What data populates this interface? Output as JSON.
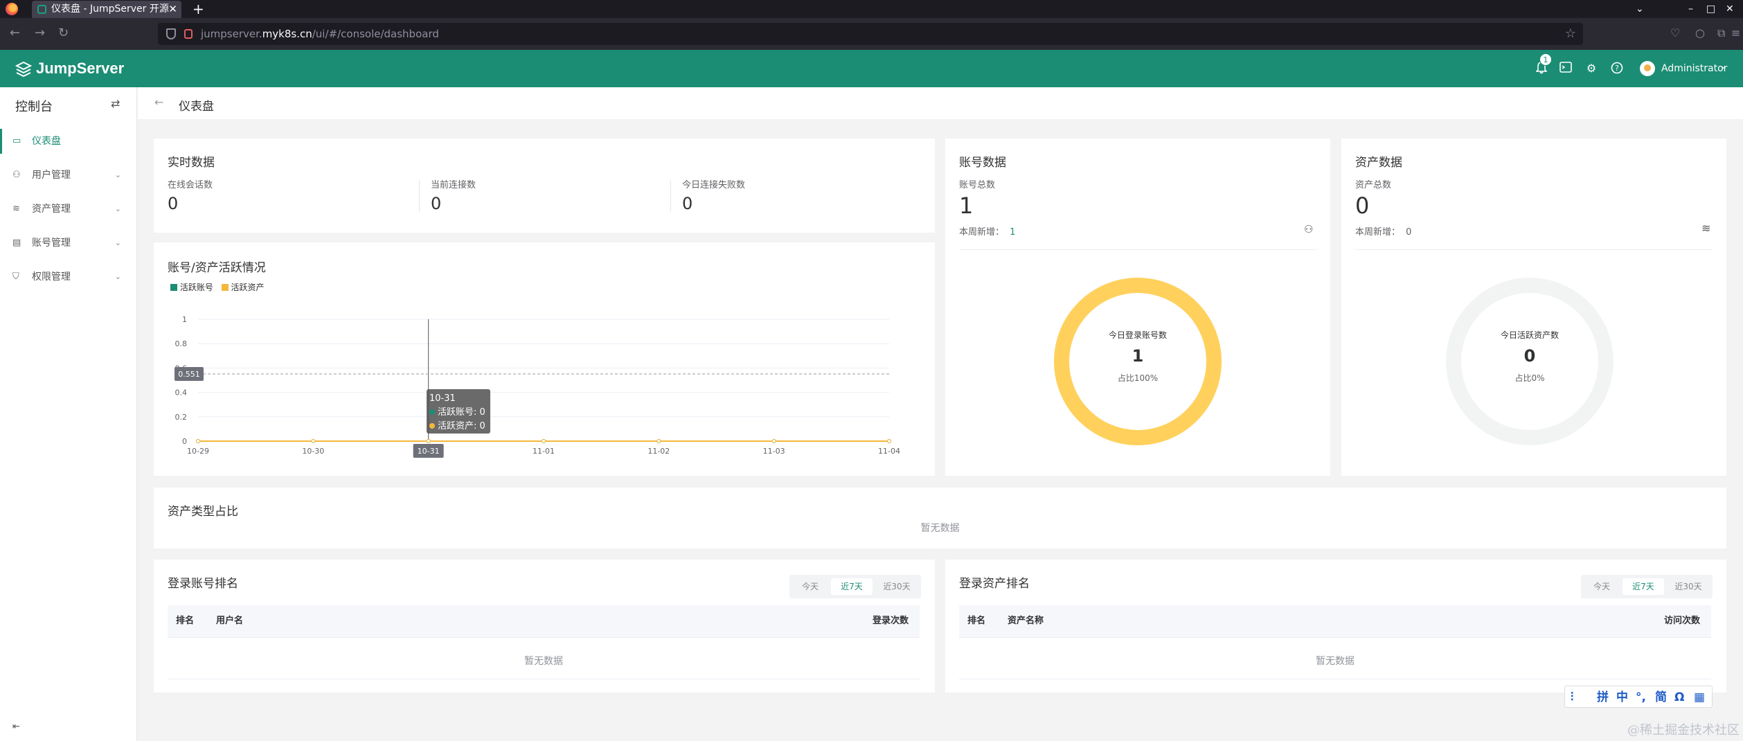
{
  "browser": {
    "tab_title": "仪表盘 - JumpServer 开源",
    "tab_close": "✕",
    "new_tab": "+",
    "url_prefix": "jumpserver.",
    "url_host": "myk8s.cn",
    "url_path": "/ui/#/console/dashboard"
  },
  "header": {
    "logo": "JumpServer",
    "notification_count": "1",
    "user": "Administrator"
  },
  "sidebar": {
    "title": "控制台",
    "items": [
      {
        "label": "仪表盘",
        "active": true
      },
      {
        "label": "用户管理"
      },
      {
        "label": "资产管理"
      },
      {
        "label": "账号管理"
      },
      {
        "label": "权限管理"
      }
    ]
  },
  "page": {
    "title": "仪表盘"
  },
  "realtime": {
    "title": "实时数据",
    "stats": [
      {
        "label": "在线会话数",
        "value": "0"
      },
      {
        "label": "当前连接数",
        "value": "0"
      },
      {
        "label": "今日连接失败数",
        "value": "0"
      }
    ]
  },
  "activity": {
    "title": "账号/资产活跃情况",
    "legend": [
      "活跃账号",
      "活跃资产"
    ],
    "pointer_value": "0.551",
    "tooltip": {
      "date": "10-31",
      "line1": "活跃账号: 0",
      "line2": "活跃资产: 0"
    },
    "x_pointer_label": "10-31"
  },
  "chart_data": {
    "type": "line",
    "title": "账号/资产活跃情况",
    "categories": [
      "10-29",
      "10-30",
      "10-31",
      "11-01",
      "11-02",
      "11-03",
      "11-04"
    ],
    "yticks": [
      "0",
      "0.2",
      "0.4",
      "0.6",
      "0.8",
      "1"
    ],
    "ylim": [
      0,
      1
    ],
    "legend_position": "top-left",
    "series": [
      {
        "name": "活跃账号",
        "color": "#1b8d74",
        "values": [
          0,
          0,
          0,
          0,
          0,
          0,
          0
        ]
      },
      {
        "name": "活跃资产",
        "color": "#f4b73a",
        "values": [
          0,
          0,
          0,
          0,
          0,
          0,
          0
        ]
      }
    ]
  },
  "accounts": {
    "title": "账号数据",
    "total_label": "账号总数",
    "total": "1",
    "week_label": "本周新增：",
    "week_value": "1",
    "donut_title": "今日登录账号数",
    "donut_value": "1",
    "donut_ratio": "占比100%",
    "donut_fraction": 1.0,
    "donut_color": "#ffd15c"
  },
  "assets": {
    "title": "资产数据",
    "total_label": "资产总数",
    "total": "0",
    "week_label": "本周新增：",
    "week_value": "0",
    "donut_title": "今日活跃资产数",
    "donut_value": "0",
    "donut_ratio": "占比0%",
    "donut_fraction": 0.0
  },
  "asset_types": {
    "title": "资产类型占比",
    "empty": "暂无数据"
  },
  "login_accounts": {
    "title": "登录账号排名",
    "ranges": [
      "今天",
      "近7天",
      "近30天"
    ],
    "columns": [
      "排名",
      "用户名",
      "登录次数"
    ],
    "empty": "暂无数据"
  },
  "login_assets": {
    "title": "登录资产排名",
    "ranges": [
      "今天",
      "近7天",
      "近30天"
    ],
    "columns": [
      "排名",
      "资产名称",
      "访问次数"
    ],
    "empty": "暂无数据"
  },
  "ime": [
    "拼",
    "中",
    "°,",
    "简",
    "Ω"
  ],
  "watermark": "@稀土掘金技术社区"
}
